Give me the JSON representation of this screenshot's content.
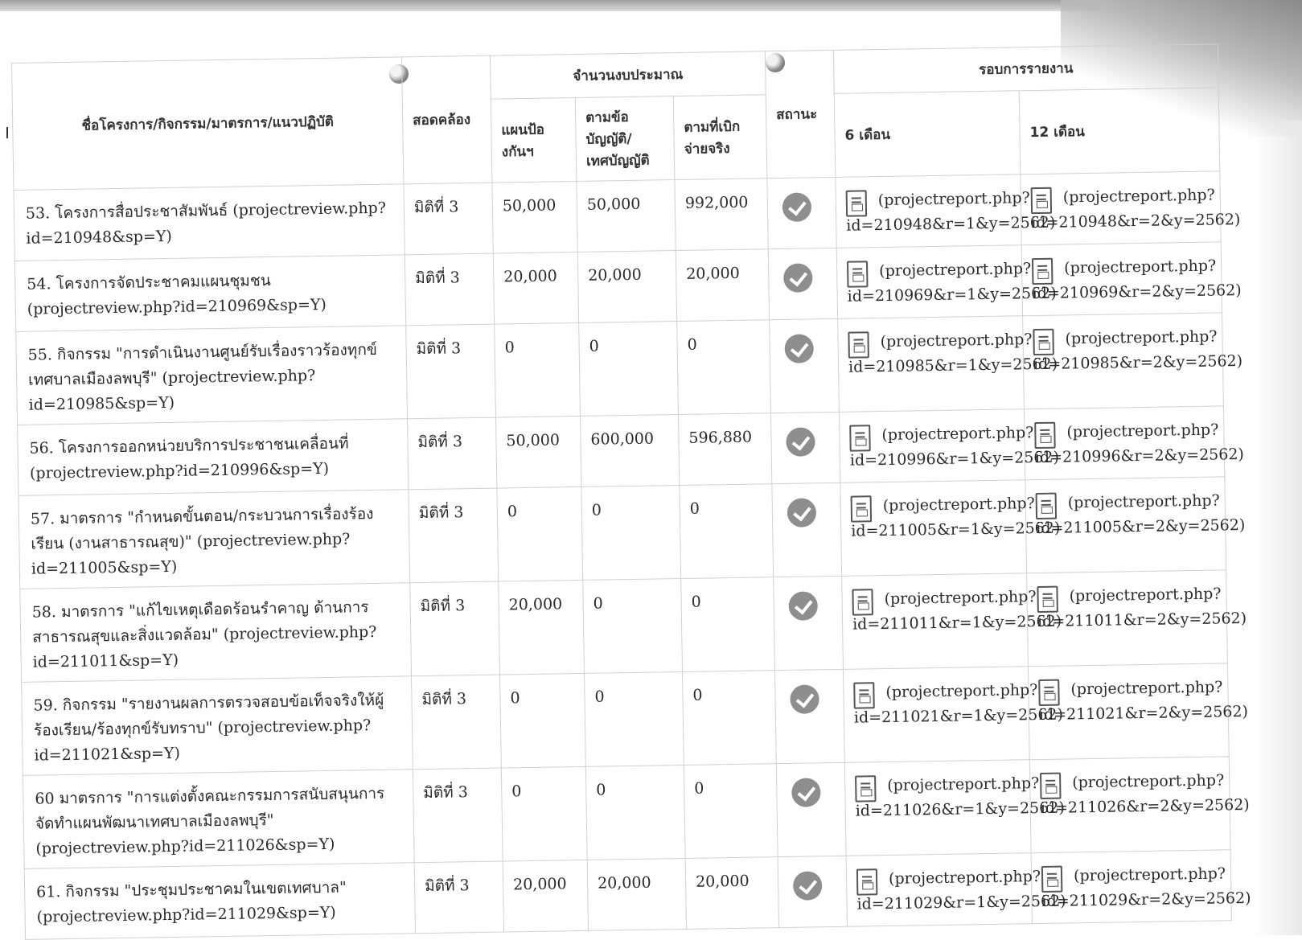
{
  "header": {
    "name_col": "ชื่อโครงการ/กิจกรรม/มาตรการ/แนวปฏิบัติ",
    "align_col": "สอดคล้อง",
    "budget_group": "จำนวนงบประมาณ",
    "budget_plan": "แผนป้องกันฯ",
    "budget_act": "ตามข้อบัญญัติ/เทศบัญญัติ",
    "budget_actual": "ตามที่เบิกจ่ายจริง",
    "status_col": "สถานะ",
    "report_group": "รอบการรายงาน",
    "report_6m": "6 เดือน",
    "report_12m": "12 เดือน"
  },
  "rows": [
    {
      "name": "53. โครงการสื่อประชาสัมพันธ์ (projectreview.php?id=210948&sp=Y)",
      "alignment": "มิติที่ 3",
      "plan_budget": "50,000",
      "act_budget": "50,000",
      "actual_budget": "992,000",
      "status_icon": "check-circle-icon",
      "report_6m_a": "(projectreport.php?",
      "report_6m_b": "id=210948&r=1&y=2562)",
      "report_12m_a": "(projectreport.php?",
      "report_12m_b": "id=210948&r=2&y=2562)"
    },
    {
      "name": "54. โครงการจัดประชาคมแผนชุมชน (projectreview.php?id=210969&sp=Y)",
      "alignment": "มิติที่ 3",
      "plan_budget": "20,000",
      "act_budget": "20,000",
      "actual_budget": "20,000",
      "status_icon": "check-circle-icon",
      "report_6m_a": "(projectreport.php?",
      "report_6m_b": "id=210969&r=1&y=2562)",
      "report_12m_a": "(projectreport.php?",
      "report_12m_b": "id=210969&r=2&y=2562)"
    },
    {
      "name": "55. กิจกรรม \"การดำเนินงานศูนย์รับเรื่องราวร้องทุกข์เทศบาลเมืองลพบุรี\" (projectreview.php?id=210985&sp=Y)",
      "alignment": "มิติที่ 3",
      "plan_budget": "0",
      "act_budget": "0",
      "actual_budget": "0",
      "status_icon": "check-circle-icon",
      "report_6m_a": "(projectreport.php?",
      "report_6m_b": "id=210985&r=1&y=2562)",
      "report_12m_a": "(projectreport.php?",
      "report_12m_b": "id=210985&r=2&y=2562)"
    },
    {
      "name": "56. โครงการออกหน่วยบริการประชาชนเคลื่อนที่ (projectreview.php?id=210996&sp=Y)",
      "alignment": "มิติที่ 3",
      "plan_budget": "50,000",
      "act_budget": "600,000",
      "actual_budget": "596,880",
      "status_icon": "check-circle-icon",
      "report_6m_a": "(projectreport.php?",
      "report_6m_b": "id=210996&r=1&y=2562)",
      "report_12m_a": "(projectreport.php?",
      "report_12m_b": "id=210996&r=2&y=2562)"
    },
    {
      "name": "57. มาตรการ \"กำหนดขั้นตอน/กระบวนการเรื่องร้องเรียน (งานสาธารณสุข)\" (projectreview.php?id=211005&sp=Y)",
      "alignment": "มิติที่ 3",
      "plan_budget": "0",
      "act_budget": "0",
      "actual_budget": "0",
      "status_icon": "check-circle-icon",
      "report_6m_a": "(projectreport.php?",
      "report_6m_b": "id=211005&r=1&y=2562)",
      "report_12m_a": "(projectreport.php?",
      "report_12m_b": "id=211005&r=2&y=2562)"
    },
    {
      "name": "58. มาตรการ \"แก้ไขเหตุเดือดร้อนรำคาญ ด้านการสาธารณสุขและสิ่งแวดล้อม\" (projectreview.php?id=211011&sp=Y)",
      "alignment": "มิติที่ 3",
      "plan_budget": "20,000",
      "act_budget": "0",
      "actual_budget": "0",
      "status_icon": "check-circle-icon",
      "report_6m_a": "(projectreport.php?",
      "report_6m_b": "id=211011&r=1&y=2562)",
      "report_12m_a": "(projectreport.php?",
      "report_12m_b": "id=211011&r=2&y=2562)"
    },
    {
      "name": "59. กิจกรรม \"รายงานผลการตรวจสอบข้อเท็จจริงให้ผู้ร้องเรียน/ร้องทุกข์รับทราบ\" (projectreview.php?id=211021&sp=Y)",
      "alignment": "มิติที่ 3",
      "plan_budget": "0",
      "act_budget": "0",
      "actual_budget": "0",
      "status_icon": "check-circle-icon",
      "report_6m_a": "(projectreport.php?",
      "report_6m_b": "id=211021&r=1&y=2562)",
      "report_12m_a": "(projectreport.php?",
      "report_12m_b": "id=211021&r=2&y=2562)"
    },
    {
      "name": "60 มาตรการ \"การแต่งตั้งคณะกรรมการสนับสนุนการจัดทำแผนพัฒนาเทศบาลเมืองลพบุรี\" (projectreview.php?id=211026&sp=Y)",
      "alignment": "มิติที่ 3",
      "plan_budget": "0",
      "act_budget": "0",
      "actual_budget": "0",
      "status_icon": "check-circle-icon",
      "report_6m_a": "(projectreport.php?",
      "report_6m_b": "id=211026&r=1&y=2562)",
      "report_12m_a": "(projectreport.php?",
      "report_12m_b": "id=211026&r=2&y=2562)"
    },
    {
      "name": "61. กิจกรรม \"ประชุมประชาคมในเขตเทศบาล\" (projectreview.php?id=211029&sp=Y)",
      "alignment": "มิติที่ 3",
      "plan_budget": "20,000",
      "act_budget": "20,000",
      "actual_budget": "20,000",
      "status_icon": "check-circle-icon",
      "report_6m_a": "(projectreport.php?",
      "report_6m_b": "id=211029&r=1&y=2562)",
      "report_12m_a": "(projectreport.php?",
      "report_12m_b": "id=211029&r=2&y=2562)"
    }
  ],
  "icons": {
    "status": "check-circle-icon",
    "report": "document-report-icon"
  },
  "colors": {
    "status_icon": "#8e8e8e",
    "grid_line": "#d0d0d0",
    "text": "#2a2a2a"
  }
}
